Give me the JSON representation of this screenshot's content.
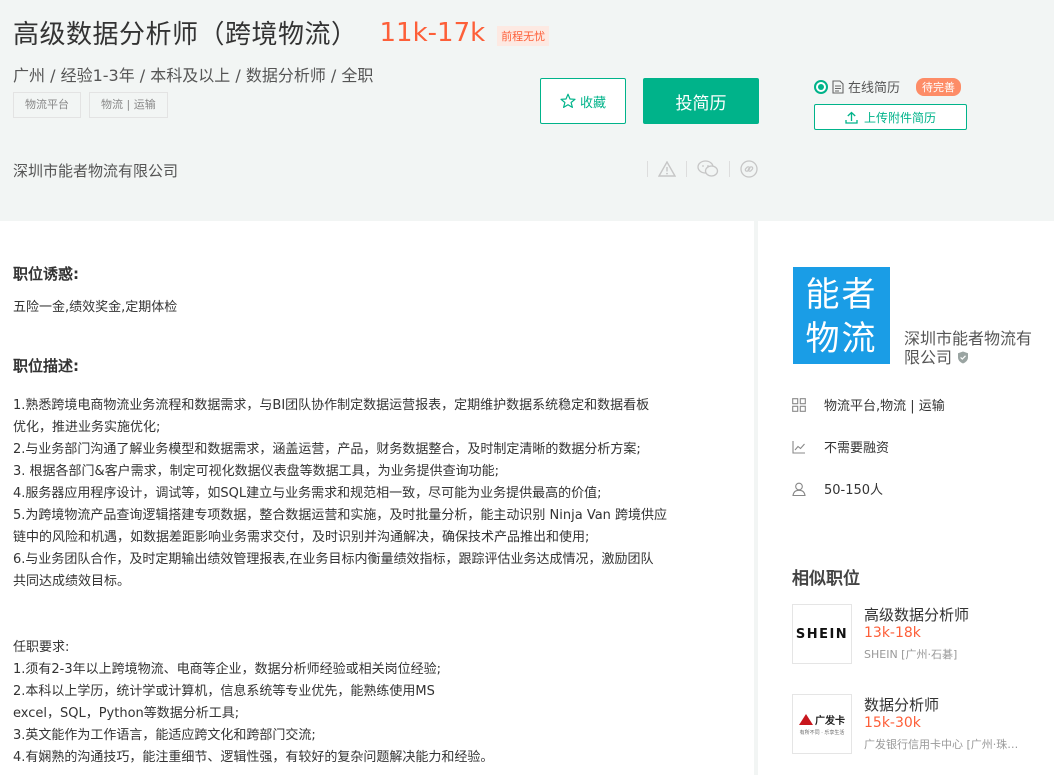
{
  "job": {
    "title": "高级数据分析师（跨境物流）",
    "salary": "11k-17k",
    "salary_tag": "前程无忧",
    "meta": "广州 / 经验1-3年 / 本科及以上 / 数据分析师 / 全职",
    "tags": [
      "物流平台",
      "物流 | 运输"
    ],
    "company": "深圳市能者物流有限公司"
  },
  "actions": {
    "favorite_label": "收藏",
    "apply_label": "投简历",
    "online_resume_label": "在线简历",
    "pending_badge": "待完善",
    "upload_label": "上传附件简历"
  },
  "content": {
    "perks_title": "职位诱惑:",
    "perks": "五险一金,绩效奖金,定期体检",
    "desc_title": "职位描述:",
    "desc_lines": [
      "1.熟悉跨境电商物流业务流程和数据需求，与BI团队协作制定数据运营报表，定期维护数据系统稳定和数据看板",
      "优化，推进业务实施优化;",
      "2.与业务部门沟通了解业务模型和数据需求，涵盖运营，产品，财务数据整合，及时制定清晰的数据分析方案;",
      "3. 根据各部门&客户需求，制定可视化数据仪表盘等数据工具，为业务提供查询功能;",
      "4.服务器应用程序设计，调试等，如SQL建立与业务需求和规范相一致，尽可能为业务提供最高的价值;",
      "5.为跨境物流产品查询逻辑搭建专项数据，整合数据运营和实施，及时批量分析，能主动识别 Ninja Van 跨境供应",
      "链中的风险和机遇，如数据差距影响业务需求交付，及时识别并沟通解决，确保技术产品推出和使用;",
      "6.与业务团队合作，及时定期输出绩效管理报表,在业务目标内衡量绩效指标，跟踪评估业务达成情况，激励团队",
      "共同达成绩效目标。"
    ],
    "req_title": "任职要求:",
    "req_lines": [
      "1.须有2-3年以上跨境物流、电商等企业，数据分析师经验或相关岗位经验;",
      "2.本科以上学历，统计学或计算机，信息系统等专业优先，能熟练使用MS",
      "excel，SQL，Python等数据分析工具;",
      "3.英文能作为工作语言，能适应跨文化和跨部门交流;",
      "4.有娴熟的沟通技巧，能注重细节、逻辑性强，有较好的复杂问题解决能力和经验。"
    ]
  },
  "sidebar": {
    "logo_line1": "能者",
    "logo_line2": "物流",
    "company_full": "深圳市能者物流有限公司",
    "industry": "物流平台,物流 | 运输",
    "funding": "不需要融资",
    "size": "50-150人",
    "similar_title": "相似职位",
    "similar": [
      {
        "logo_text": "SHEIN",
        "title": "高级数据分析师",
        "salary": "13k-18k",
        "company": "SHEIN [广州·石碁]"
      },
      {
        "logo_text": "广发卡",
        "logo_sub": "有所不同 · 乐享生活",
        "title": "数据分析师",
        "salary": "15k-30k",
        "company": "广发银行信用卡中心 [广州·珠…"
      }
    ]
  },
  "colors": {
    "accent": "#00b38a",
    "salary": "#fd5f39",
    "logo_bg": "#1a9de6",
    "header_bg": "#f2f5f4"
  }
}
